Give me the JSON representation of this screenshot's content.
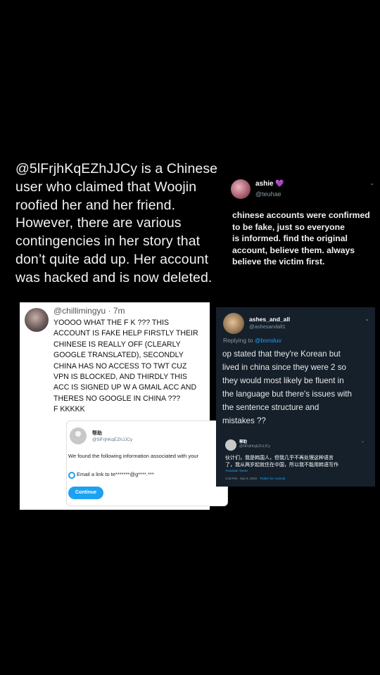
{
  "headline": {
    "line1": "@5lFrjhKqEZhJJCy is a Chinese",
    "line2": "user who claimed that Woojin",
    "line3": "roofied her and her friend.",
    "line4": "However, there are various",
    "line5": "contingencies in her story that",
    "line6": "don’t quite add up. Her account",
    "line7": "was hacked and is now deleted."
  },
  "ashie_tweet": {
    "name": "ashie",
    "heart": "💜",
    "handle": "@teuhae",
    "chevron": "⌄",
    "line1": "chinese accounts were confirmed",
    "line2": "to be fake, just so everyone",
    "line3": "is informed. find the original",
    "line4": "account, believe them. always",
    "line5": "believe the victim first."
  },
  "left_card": {
    "handle": "@chillimingyu · 7m",
    "line1": "YOOOO WHAT THE F     K ??? THIS",
    "line2": "ACCOUNT IS FAKE HELP FIRSTLY THEIR",
    "line3": "CHINESE IS REALLY OFF (CLEARLY",
    "line4": "GOOGLE TRANSLATED), SECONDLY",
    "line5": "CHINA HAS NO ACCESS TO TWT CUZ",
    "line6": "VPN IS BLOCKED, AND THIRDLY THIS",
    "line7": "ACC IS SIGNED UP W A GMAIL ACC AND",
    "line8": "THERES NO GOOGLE IN CHINA ???",
    "line9": "F     KKKKK",
    "inner": {
      "name": "帮助",
      "handle": "@5lFrjhKqEZhJJCy",
      "found": "We found the following information associated with your",
      "email": "Email a link to te*******@g****.***",
      "button": "Continue"
    }
  },
  "right_card": {
    "name": "ashes_and_all",
    "handle": "@ashesandall1",
    "chevron": "⌄",
    "reply_prefix": "Replying to ",
    "reply_handle": "@bonsluv",
    "line1": "op stated that they're Korean but",
    "line2": "lived in china since they were 2 so",
    "line3": "they would most likely be fluent in",
    "line4": "the language but there's issues with",
    "line5": "the sentence structure and",
    "line6": "mistakes ??",
    "inner": {
      "name": "帮助",
      "handle": "@5lFrjhKqEZhJJCy",
      "chevron": "⌄",
      "text1": "伙计们，我是韩国人，但我几乎不再处理这种语言",
      "text2": "了，我从两岁起就住在中国，所以我不能用韩语写作",
      "translate": "Translate Tweet",
      "meta": "3:18 PM · Sep 8, 2020 · ",
      "source": "Twitter for Android"
    }
  }
}
